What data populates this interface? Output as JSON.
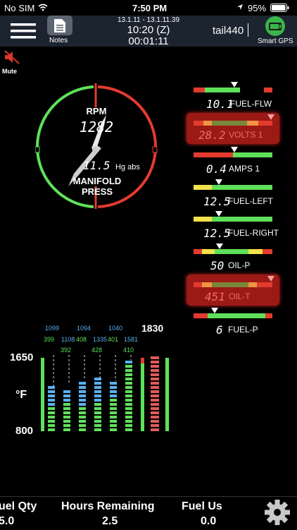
{
  "status_bar": {
    "carrier": "No SIM",
    "time": "7:50 PM",
    "battery": "95%"
  },
  "header": {
    "notes_label": "Notes",
    "date_range": "13.1.11 - 13.1.11.39",
    "zulu_time": "10:20 (Z)",
    "elapsed": "00:01:11",
    "tail_input_value": "tail440",
    "smart_gps_label": "Smart GPS"
  },
  "mute_label": "Mute",
  "dial": {
    "rpm_label": "RPM",
    "rpm_value": "1282",
    "manifold_value": "11.5",
    "manifold_unit": "Hg abs",
    "manifold_label_1": "MANIFOLD",
    "manifold_label_2": "PRESS"
  },
  "gauges": [
    {
      "value": "10.1",
      "label": "FUEL-FLW",
      "alert": false
    },
    {
      "value": "28.2",
      "label": "VOLTS 1",
      "alert": true
    },
    {
      "value": "0.4",
      "label": "AMPS 1",
      "alert": false
    },
    {
      "value": "12.5",
      "label": "FUEL-LEFT",
      "alert": false
    },
    {
      "value": "12.5",
      "label": "FUEL-RIGHT",
      "alert": false
    },
    {
      "value": "50",
      "label": "OIL-P",
      "alert": false
    },
    {
      "value": "451",
      "label": "OIL-T",
      "alert": true
    },
    {
      "value": "6",
      "label": "FUEL-P",
      "alert": false
    }
  ],
  "egt": {
    "top_values": [
      "1099",
      "1094",
      "1040"
    ],
    "mid_values": [
      "399",
      "1108",
      "408",
      "1335",
      "401",
      "1581"
    ],
    "low_values": [
      "392",
      "428",
      "410"
    ],
    "max_value": "1830",
    "y_top": "1650",
    "y_unit": "°F",
    "y_bottom": "800"
  },
  "bottom_bar": {
    "fuel_qty_label": "uel Qty",
    "fuel_qty_value": "5.0",
    "hours_label": "Hours Remaining",
    "hours_value": "2.5",
    "fuel_used_label": "Fuel Us",
    "fuel_used_value": "0.0"
  },
  "colors": {
    "green": "#5fe05a",
    "red": "#e23b2e",
    "yellow": "#f1e24a",
    "orange": "#f09540",
    "blue": "#5ab0f0",
    "header_bg": "#1c2430"
  },
  "icons": [
    "wifi-icon",
    "location-arrow-icon",
    "battery-icon",
    "menu-icon",
    "notes-icon",
    "gps-device-icon",
    "mute-speaker-icon",
    "gear-icon"
  ]
}
